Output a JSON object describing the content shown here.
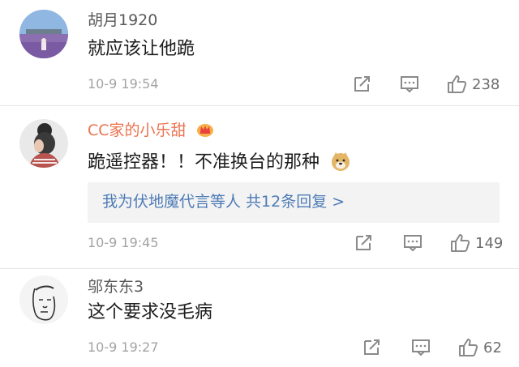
{
  "comments": [
    {
      "username": "胡月1920",
      "text": "就应该让他跪",
      "time": "10-9 19:54",
      "likes": "238",
      "avatar_icon": "lavender-field-avatar-icon"
    },
    {
      "username": "CC家的小乐甜",
      "username_color": "#eb7350",
      "badge_icon": "crown-vip-icon",
      "text": "跪遥控器！！不准换台的那种",
      "emoji_icon": "doge-emoji-icon",
      "replies_text": "我为伏地魔代言等人  共12条回复 >",
      "time": "10-9 19:45",
      "likes": "149",
      "avatar_icon": "girl-bun-avatar-icon"
    },
    {
      "username": "邬东东3",
      "text": "这个要求没毛病",
      "time": "10-9 19:27",
      "likes": "62",
      "avatar_icon": "cartoon-face-avatar-icon"
    }
  ],
  "colors": {
    "link": "#4d7bb6",
    "meta": "#a3a3a3",
    "icon": "#8a8a8a"
  },
  "action_icons": [
    "share-icon",
    "comment-icon",
    "like-icon"
  ]
}
